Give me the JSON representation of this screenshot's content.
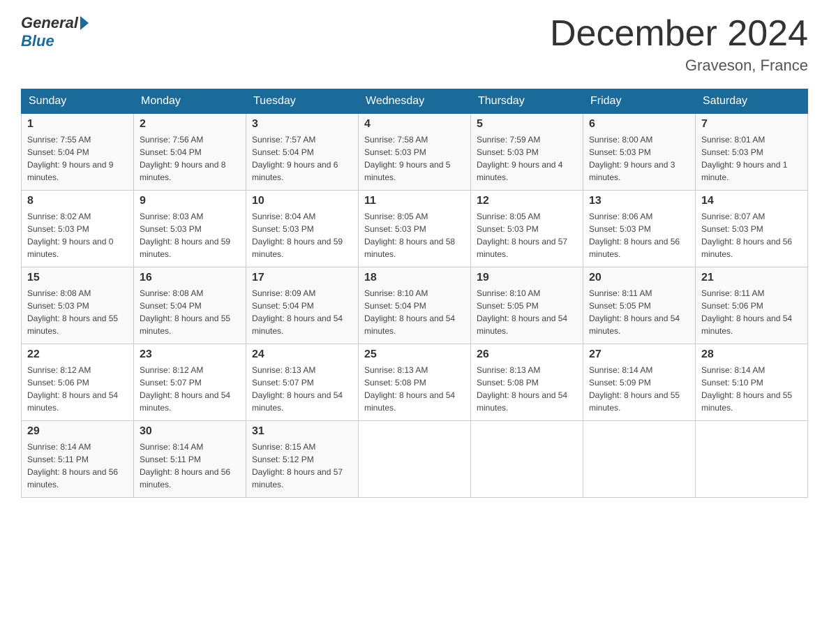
{
  "header": {
    "logo_general": "General",
    "logo_blue": "Blue",
    "title": "December 2024",
    "location": "Graveson, France"
  },
  "days_of_week": [
    "Sunday",
    "Monday",
    "Tuesday",
    "Wednesday",
    "Thursday",
    "Friday",
    "Saturday"
  ],
  "weeks": [
    [
      {
        "day": "1",
        "sunrise": "7:55 AM",
        "sunset": "5:04 PM",
        "daylight": "9 hours and 9 minutes."
      },
      {
        "day": "2",
        "sunrise": "7:56 AM",
        "sunset": "5:04 PM",
        "daylight": "9 hours and 8 minutes."
      },
      {
        "day": "3",
        "sunrise": "7:57 AM",
        "sunset": "5:04 PM",
        "daylight": "9 hours and 6 minutes."
      },
      {
        "day": "4",
        "sunrise": "7:58 AM",
        "sunset": "5:03 PM",
        "daylight": "9 hours and 5 minutes."
      },
      {
        "day": "5",
        "sunrise": "7:59 AM",
        "sunset": "5:03 PM",
        "daylight": "9 hours and 4 minutes."
      },
      {
        "day": "6",
        "sunrise": "8:00 AM",
        "sunset": "5:03 PM",
        "daylight": "9 hours and 3 minutes."
      },
      {
        "day": "7",
        "sunrise": "8:01 AM",
        "sunset": "5:03 PM",
        "daylight": "9 hours and 1 minute."
      }
    ],
    [
      {
        "day": "8",
        "sunrise": "8:02 AM",
        "sunset": "5:03 PM",
        "daylight": "9 hours and 0 minutes."
      },
      {
        "day": "9",
        "sunrise": "8:03 AM",
        "sunset": "5:03 PM",
        "daylight": "8 hours and 59 minutes."
      },
      {
        "day": "10",
        "sunrise": "8:04 AM",
        "sunset": "5:03 PM",
        "daylight": "8 hours and 59 minutes."
      },
      {
        "day": "11",
        "sunrise": "8:05 AM",
        "sunset": "5:03 PM",
        "daylight": "8 hours and 58 minutes."
      },
      {
        "day": "12",
        "sunrise": "8:05 AM",
        "sunset": "5:03 PM",
        "daylight": "8 hours and 57 minutes."
      },
      {
        "day": "13",
        "sunrise": "8:06 AM",
        "sunset": "5:03 PM",
        "daylight": "8 hours and 56 minutes."
      },
      {
        "day": "14",
        "sunrise": "8:07 AM",
        "sunset": "5:03 PM",
        "daylight": "8 hours and 56 minutes."
      }
    ],
    [
      {
        "day": "15",
        "sunrise": "8:08 AM",
        "sunset": "5:03 PM",
        "daylight": "8 hours and 55 minutes."
      },
      {
        "day": "16",
        "sunrise": "8:08 AM",
        "sunset": "5:04 PM",
        "daylight": "8 hours and 55 minutes."
      },
      {
        "day": "17",
        "sunrise": "8:09 AM",
        "sunset": "5:04 PM",
        "daylight": "8 hours and 54 minutes."
      },
      {
        "day": "18",
        "sunrise": "8:10 AM",
        "sunset": "5:04 PM",
        "daylight": "8 hours and 54 minutes."
      },
      {
        "day": "19",
        "sunrise": "8:10 AM",
        "sunset": "5:05 PM",
        "daylight": "8 hours and 54 minutes."
      },
      {
        "day": "20",
        "sunrise": "8:11 AM",
        "sunset": "5:05 PM",
        "daylight": "8 hours and 54 minutes."
      },
      {
        "day": "21",
        "sunrise": "8:11 AM",
        "sunset": "5:06 PM",
        "daylight": "8 hours and 54 minutes."
      }
    ],
    [
      {
        "day": "22",
        "sunrise": "8:12 AM",
        "sunset": "5:06 PM",
        "daylight": "8 hours and 54 minutes."
      },
      {
        "day": "23",
        "sunrise": "8:12 AM",
        "sunset": "5:07 PM",
        "daylight": "8 hours and 54 minutes."
      },
      {
        "day": "24",
        "sunrise": "8:13 AM",
        "sunset": "5:07 PM",
        "daylight": "8 hours and 54 minutes."
      },
      {
        "day": "25",
        "sunrise": "8:13 AM",
        "sunset": "5:08 PM",
        "daylight": "8 hours and 54 minutes."
      },
      {
        "day": "26",
        "sunrise": "8:13 AM",
        "sunset": "5:08 PM",
        "daylight": "8 hours and 54 minutes."
      },
      {
        "day": "27",
        "sunrise": "8:14 AM",
        "sunset": "5:09 PM",
        "daylight": "8 hours and 55 minutes."
      },
      {
        "day": "28",
        "sunrise": "8:14 AM",
        "sunset": "5:10 PM",
        "daylight": "8 hours and 55 minutes."
      }
    ],
    [
      {
        "day": "29",
        "sunrise": "8:14 AM",
        "sunset": "5:11 PM",
        "daylight": "8 hours and 56 minutes."
      },
      {
        "day": "30",
        "sunrise": "8:14 AM",
        "sunset": "5:11 PM",
        "daylight": "8 hours and 56 minutes."
      },
      {
        "day": "31",
        "sunrise": "8:15 AM",
        "sunset": "5:12 PM",
        "daylight": "8 hours and 57 minutes."
      },
      null,
      null,
      null,
      null
    ]
  ],
  "labels": {
    "sunrise": "Sunrise:",
    "sunset": "Sunset:",
    "daylight": "Daylight:"
  }
}
